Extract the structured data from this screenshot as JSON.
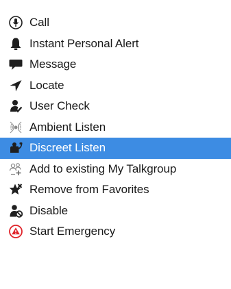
{
  "context_menu": {
    "items": [
      {
        "label": "Call",
        "icon": "microphone-circle-icon",
        "selected": false
      },
      {
        "label": "Instant Personal Alert",
        "icon": "bell-alert-icon",
        "selected": false
      },
      {
        "label": "Message",
        "icon": "speech-bubble-icon",
        "selected": false
      },
      {
        "label": "Locate",
        "icon": "location-arrow-icon",
        "selected": false
      },
      {
        "label": "User Check",
        "icon": "user-check-icon",
        "selected": false
      },
      {
        "label": "Ambient Listen",
        "icon": "ambient-listen-icon",
        "selected": false
      },
      {
        "label": "Discreet Listen",
        "icon": "discreet-listen-icon",
        "selected": true
      },
      {
        "label": "Add to existing My Talkgroup",
        "icon": "add-to-talkgroup-icon",
        "selected": false
      },
      {
        "label": "Remove from Favorites",
        "icon": "remove-favorite-star-icon",
        "selected": false
      },
      {
        "label": "Disable",
        "icon": "disable-user-icon",
        "selected": false
      },
      {
        "label": "Start Emergency",
        "icon": "emergency-warning-icon",
        "selected": false
      }
    ]
  },
  "colors": {
    "selection_background": "#3d8ce3",
    "icon_dark": "#1f1f1f",
    "emergency_red": "#e0242a"
  }
}
